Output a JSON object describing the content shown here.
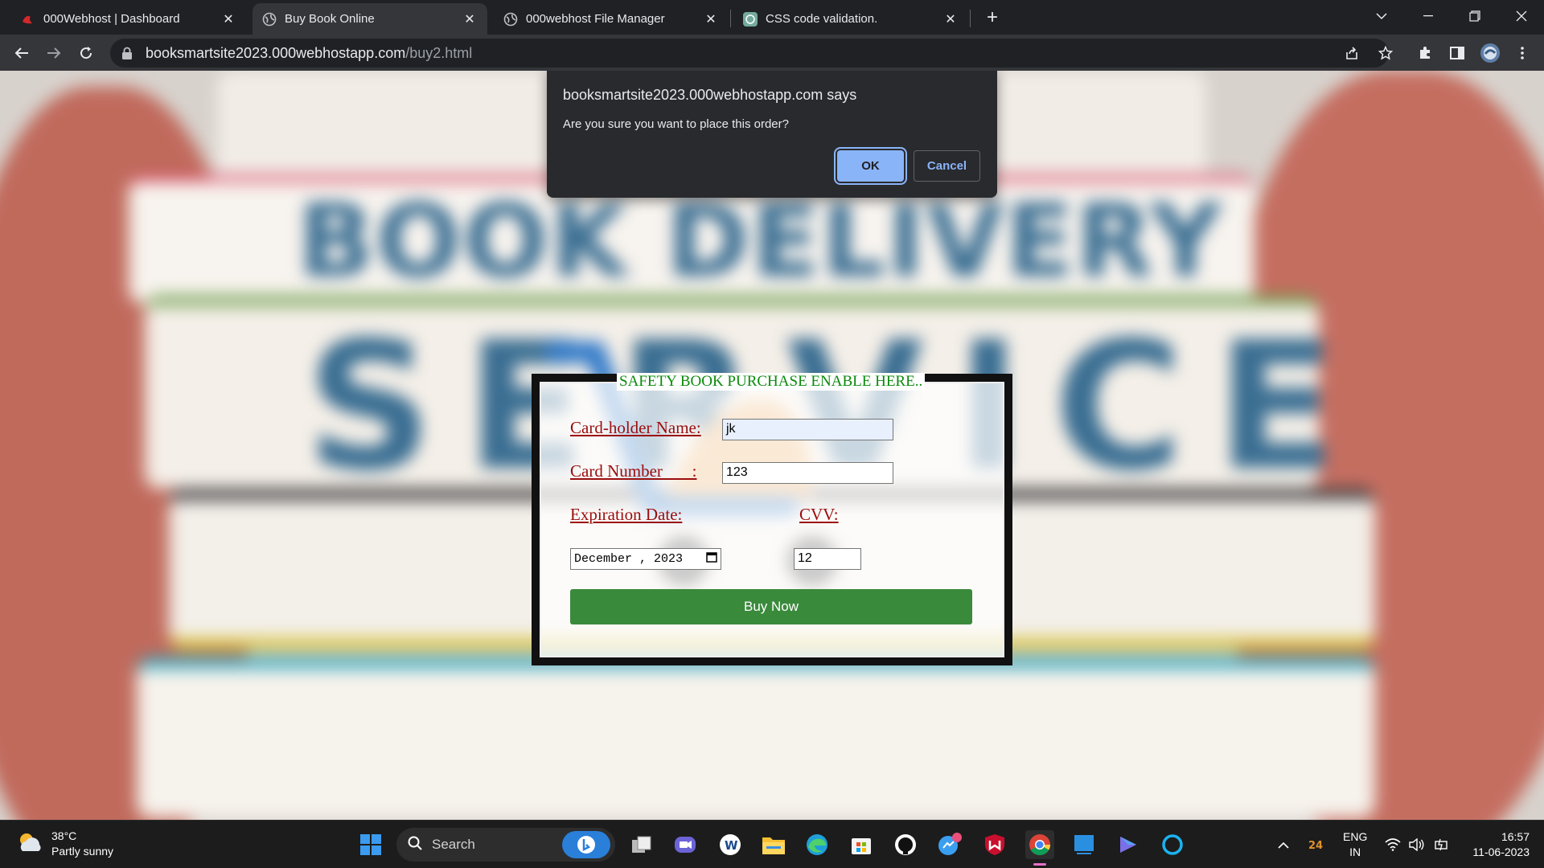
{
  "browser": {
    "tabs": [
      {
        "title": "000Webhost | Dashboard",
        "icon": "webhost-logo-icon"
      },
      {
        "title": "Buy Book Online",
        "icon": "globe-icon",
        "active": true
      },
      {
        "title": "000webhost File Manager",
        "icon": "globe-icon"
      },
      {
        "title": "CSS code validation.",
        "icon": "chatgpt-icon"
      }
    ],
    "address": {
      "host": "booksmartsite2023.000webhostapp.com",
      "path": "/buy2.html"
    }
  },
  "background": {
    "line1": "BOOK DELIVERY",
    "line2": "SERVICE"
  },
  "dialog": {
    "title": "booksmartsite2023.000webhostapp.com says",
    "message": "Are you sure you want to place this order?",
    "ok_label": "OK",
    "cancel_label": "Cancel"
  },
  "form": {
    "legend": "SAFETY BOOK PURCHASE ENABLE HERE..",
    "cardholder_label": "Card-holder Name:",
    "cardholder_value": "jk",
    "card_number_label": "Card Number       :",
    "card_number_value": "123",
    "expiration_label": "Expiration Date:",
    "expiration_value": "December , 2023",
    "cvv_label": "CVV:",
    "cvv_value": "12",
    "buy_label": "Buy Now"
  },
  "taskbar": {
    "temperature": "38°C",
    "weather_desc": "Partly sunny",
    "search_label": "Search",
    "lang_line1": "ENG",
    "lang_line2": "IN",
    "time": "16:57",
    "date": "11-06-2023"
  },
  "colors": {
    "accent_blue": "#8ab4f8",
    "buy_green": "#3a8a3c",
    "label_red": "#9b0d0d",
    "legend_green": "#0a8a0a"
  }
}
